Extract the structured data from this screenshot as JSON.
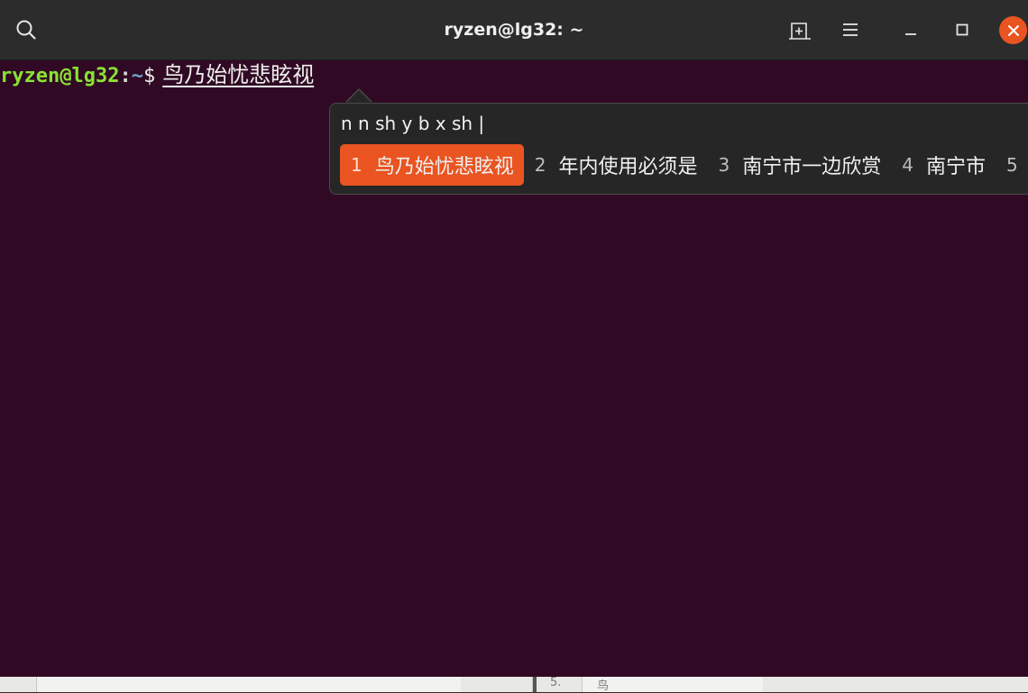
{
  "window": {
    "title": "ryzen@lg32: ~"
  },
  "headerbar": {
    "search_icon": "search-icon",
    "new_tab_icon": "new-tab-icon",
    "menu_icon": "hamburger-menu-icon",
    "minimize_icon": "minimize-icon",
    "maximize_icon": "maximize-icon",
    "close_icon": "close-icon"
  },
  "terminal": {
    "prompt_user": "ryzen@lg32",
    "prompt_colon": ":",
    "prompt_path": "~",
    "prompt_symbol": "$",
    "preedit_text": "鸟乃始忧悲眩视"
  },
  "ime": {
    "pinyin": "n n sh y b x sh |",
    "candidates": [
      {
        "num": "1",
        "text": "鸟乃始忧悲眩视"
      },
      {
        "num": "2",
        "text": "年内使用必须是"
      },
      {
        "num": "3",
        "text": "南宁市一边欣赏"
      },
      {
        "num": "4",
        "text": "南宁市"
      },
      {
        "num": "5",
        "text": ""
      }
    ],
    "selected_index": 0
  },
  "background_window": {
    "row_number": "5.",
    "cell_text": "鸟"
  },
  "colors": {
    "terminal_bg": "#300a24",
    "accent": "#e95420",
    "prompt_user": "#8ae234",
    "prompt_path": "#729fcf"
  }
}
